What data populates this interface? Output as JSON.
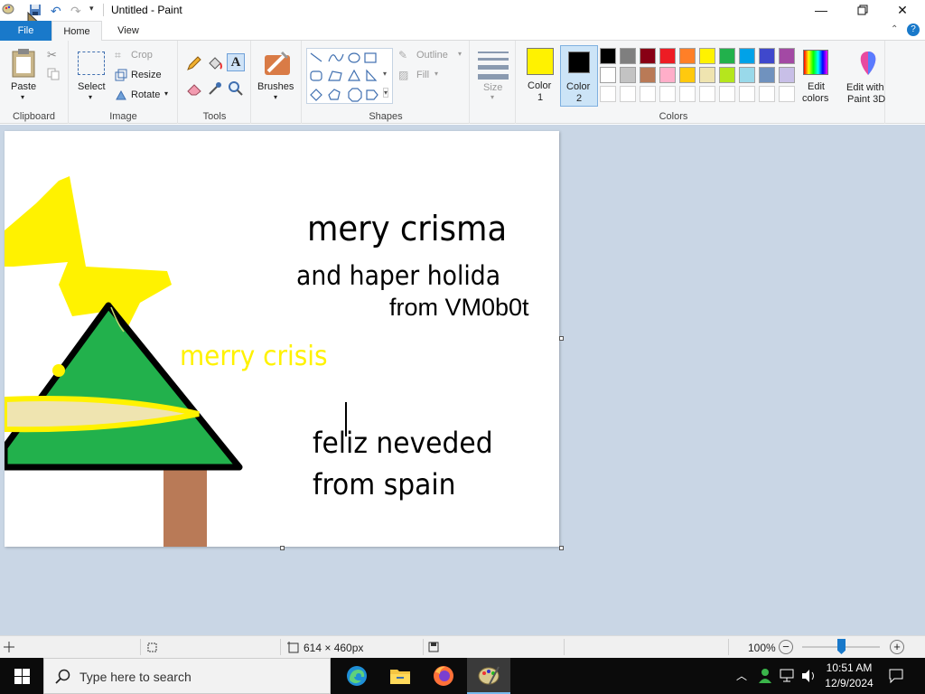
{
  "app": {
    "title": "Untitled - Paint"
  },
  "tabs": {
    "file": "File",
    "home": "Home",
    "view": "View"
  },
  "clipboard": {
    "paste": "Paste",
    "group": "Clipboard"
  },
  "image": {
    "select": "Select",
    "crop": "Crop",
    "resize": "Resize",
    "rotate": "Rotate",
    "group": "Image"
  },
  "tools": {
    "group": "Tools"
  },
  "brushes": {
    "label": "Brushes"
  },
  "shapes": {
    "outline": "Outline",
    "fill": "Fill",
    "group": "Shapes"
  },
  "size": {
    "label": "Size"
  },
  "colors": {
    "color1": "Color\n1",
    "color1_line1": "Color",
    "color1_line2": "1",
    "color2_line1": "Color",
    "color2_line2": "2",
    "color1_value": "#fff200",
    "color2_value": "#000000",
    "edit_line1": "Edit",
    "edit_line2": "colors",
    "paint3d_line1": "Edit with",
    "paint3d_line2": "Paint 3D",
    "group": "Colors",
    "palette_row1": [
      "#000000",
      "#7f7f7f",
      "#880015",
      "#ed1c24",
      "#ff7f27",
      "#fff200",
      "#22b14c",
      "#00a2e8",
      "#3f48cc",
      "#a349a4"
    ],
    "palette_row2": [
      "#ffffff",
      "#c3c3c3",
      "#b97a57",
      "#ffaec9",
      "#ffc90e",
      "#efe4b0",
      "#b5e61d",
      "#99d9ea",
      "#7092be",
      "#c8bfe7"
    ]
  },
  "drawing": {
    "line1": "mery  crisma",
    "line2": "and haper holida",
    "line3": "from VM0b0t",
    "line4": "merry crisis",
    "line5": "feliz neveded",
    "line6": "from spain"
  },
  "status": {
    "dimensions": "614 × 460px",
    "zoom": "100%"
  },
  "taskbar": {
    "search_placeholder": "Type here to search",
    "time": "10:51 AM",
    "date": "12/9/2024"
  }
}
